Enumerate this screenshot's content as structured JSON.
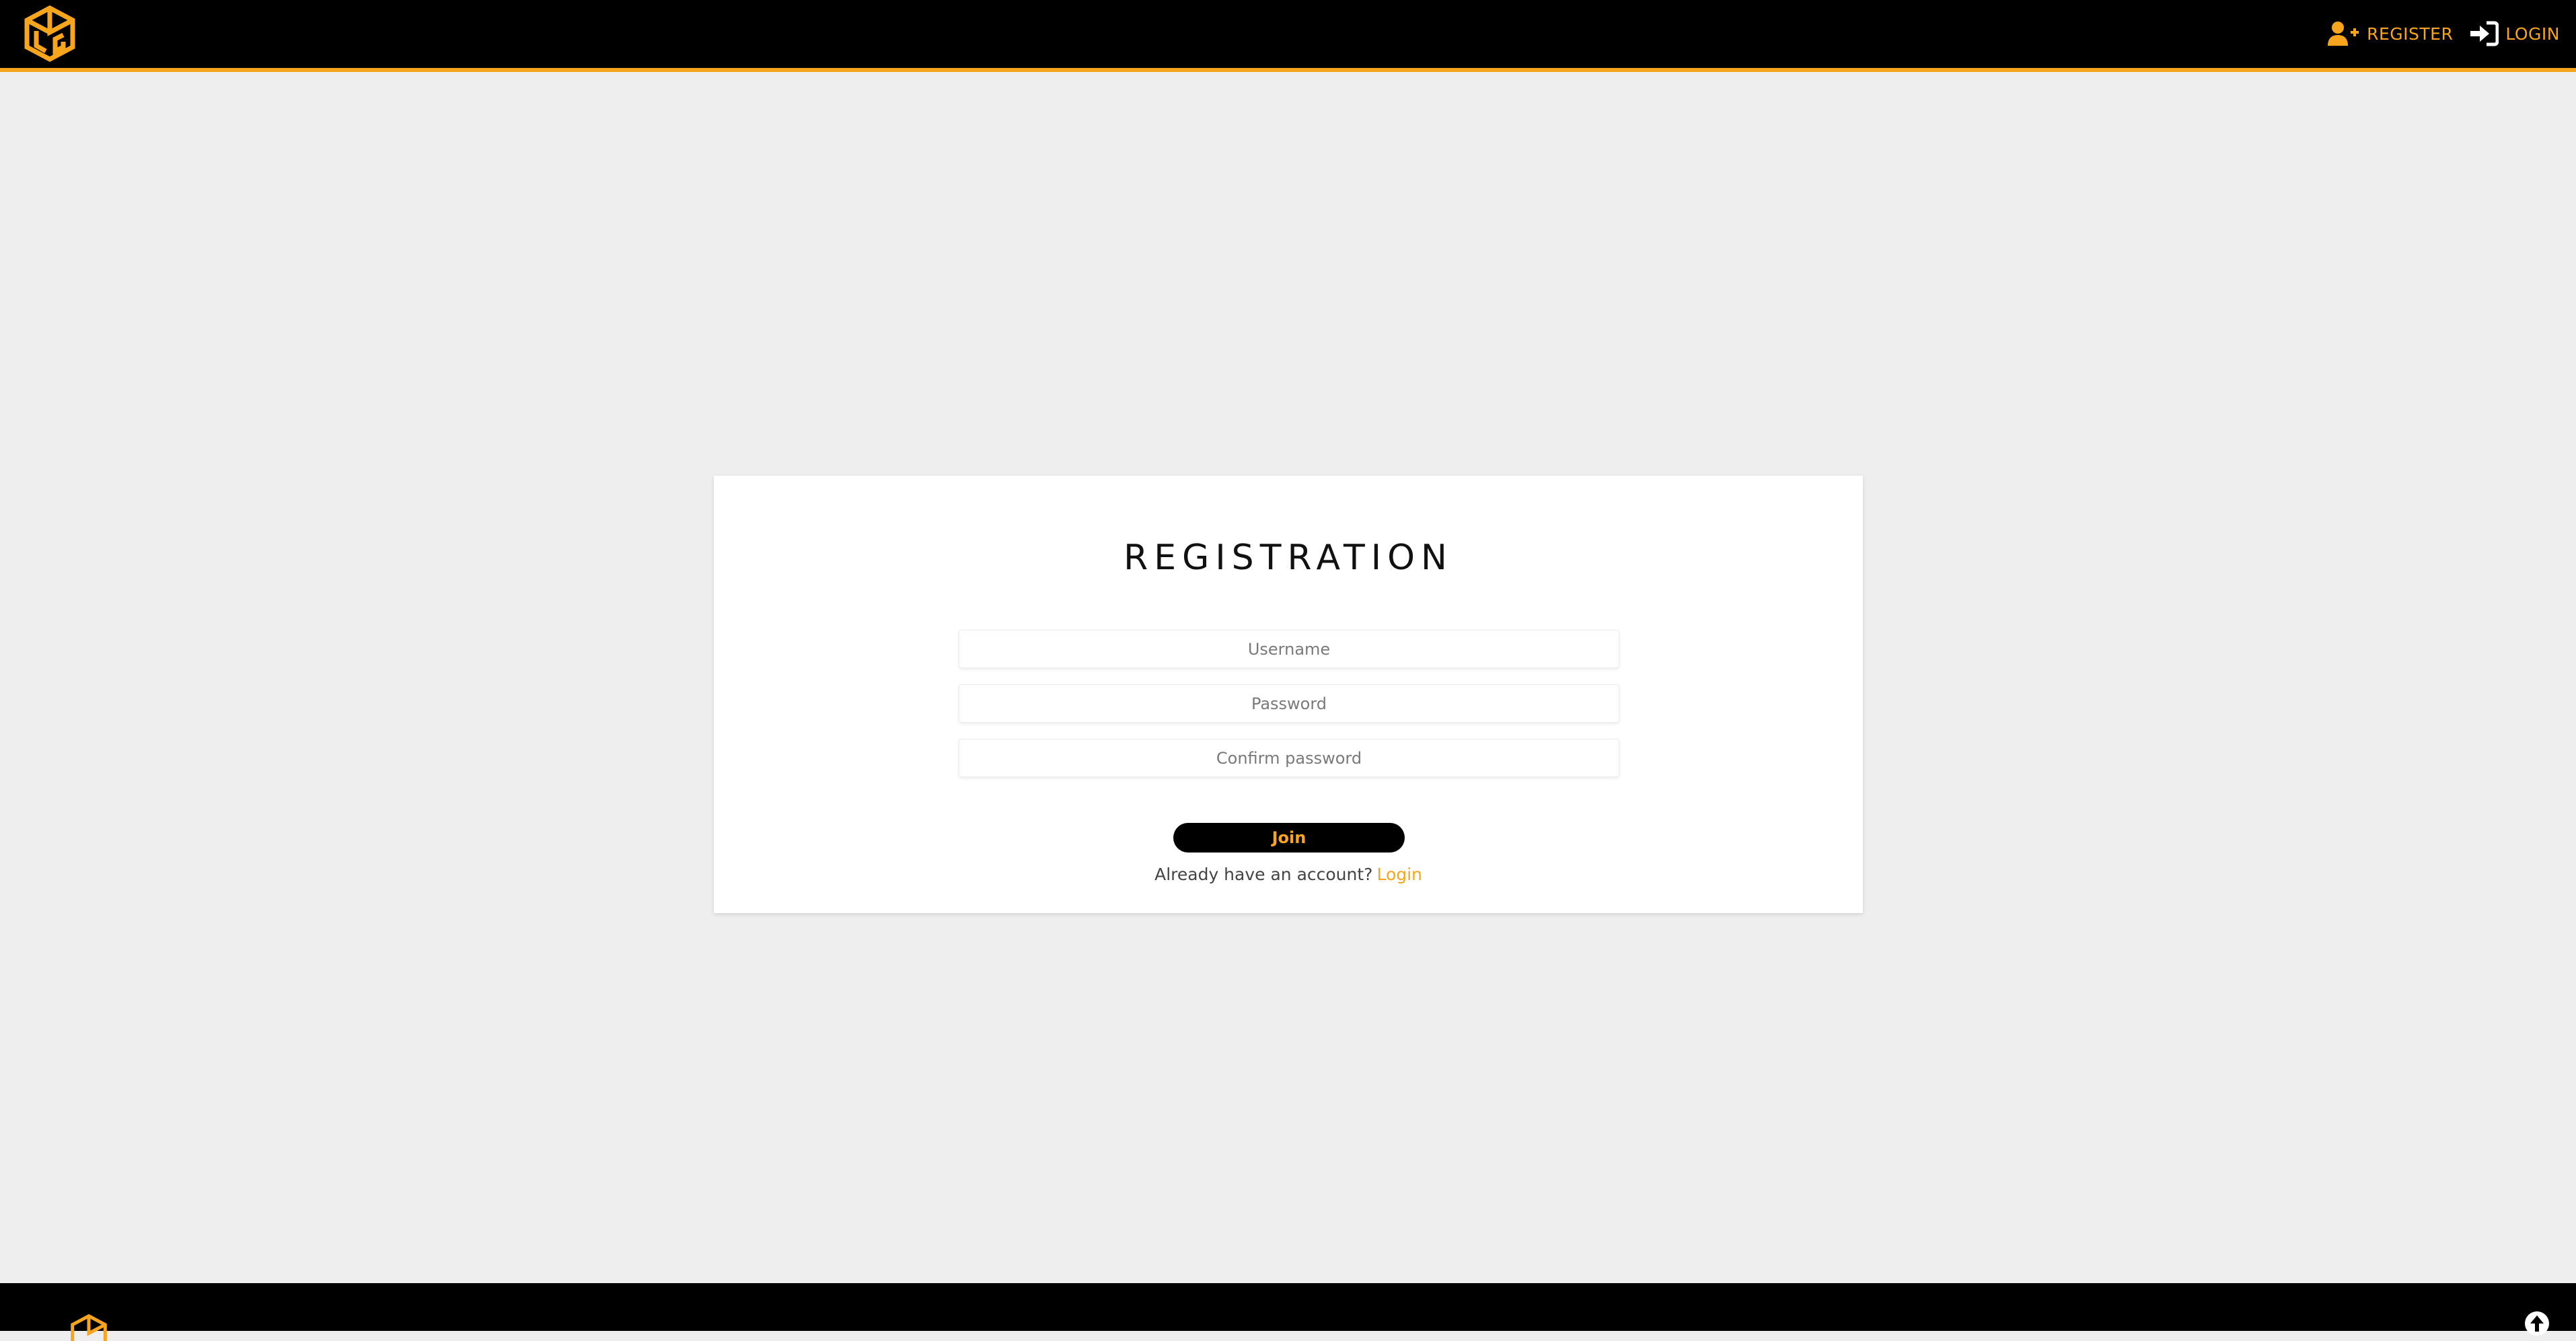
{
  "header": {
    "logo_icon": "cube-logo-icon",
    "register_label": "REGISTER",
    "register_icon": "user-plus-icon",
    "login_label": "LOGIN",
    "login_icon": "sign-in-icon"
  },
  "card": {
    "title": "REGISTRATION",
    "username_placeholder": "Username",
    "password_placeholder": "Password",
    "confirm_placeholder": "Confirm password",
    "join_label": "Join",
    "account_text": "Already have an account?",
    "login_link": "Login"
  },
  "footer": {
    "logo_icon": "cube-logo-icon",
    "scroll_icon": "arrow-up-circle-icon"
  },
  "colors": {
    "accent": "#f7a51c",
    "header_bg": "#000000",
    "page_bg": "#efeeef"
  }
}
